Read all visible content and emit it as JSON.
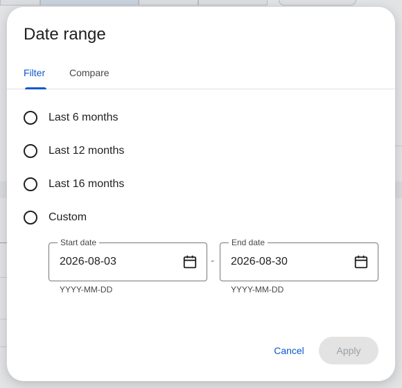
{
  "dialog": {
    "title": "Date range",
    "tabs": [
      {
        "label": "Filter",
        "active": true
      },
      {
        "label": "Compare",
        "active": false
      }
    ],
    "options": [
      {
        "label": "Last 6 months",
        "selected": false
      },
      {
        "label": "Last 12 months",
        "selected": false
      },
      {
        "label": "Last 16 months",
        "selected": false
      },
      {
        "label": "Custom",
        "selected": false
      }
    ],
    "start_date": {
      "label": "Start date",
      "value": "2026-08-03",
      "hint": "YYYY-MM-DD",
      "icon": "calendar-icon"
    },
    "end_date": {
      "label": "End date",
      "value": "2026-08-30",
      "hint": "YYYY-MM-DD",
      "icon": "calendar-icon"
    },
    "separator": "-",
    "cancel_label": "Cancel",
    "apply_label": "Apply"
  },
  "colors": {
    "accent": "#0b57d0",
    "text": "#1f1f1f",
    "apply_disabled_bg": "#e3e3e3",
    "apply_disabled_text": "#9aa0a6",
    "backdrop": "#e2e3e5"
  }
}
